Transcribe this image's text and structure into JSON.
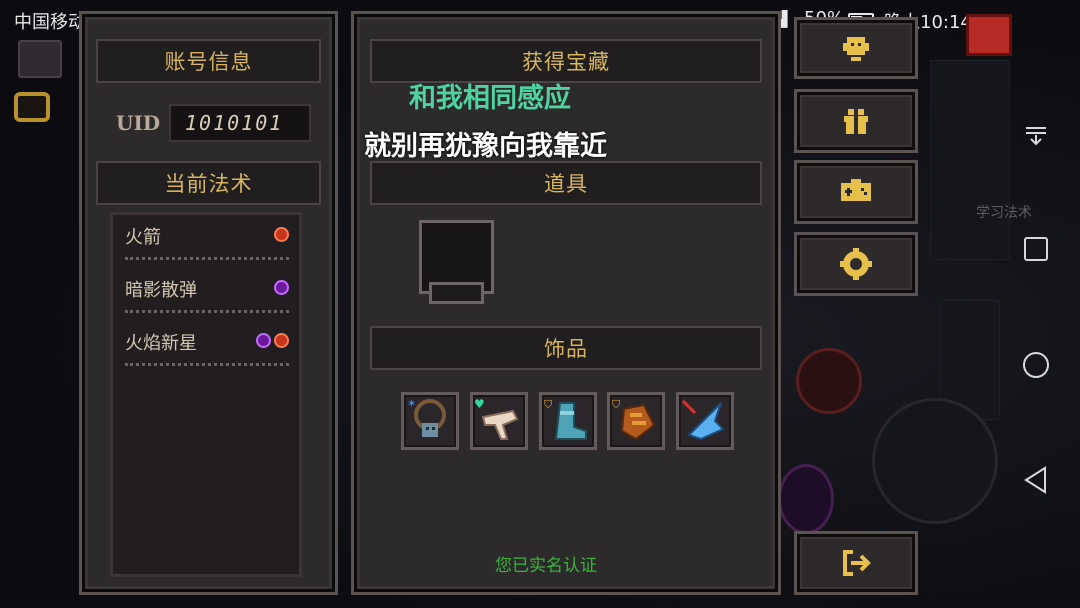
{
  "status_bar": {
    "carrier": "中国移动",
    "net_speed": "0K/s",
    "battery": "50%",
    "time": "晚上10:14"
  },
  "account_panel": {
    "title": "账号信息",
    "uid_label": "UID",
    "uid_value": "1010101",
    "spells_title": "当前法术",
    "spells": [
      {
        "name": "火箭",
        "elements": [
          "fire"
        ]
      },
      {
        "name": "暗影散弹",
        "elements": [
          "shadow"
        ]
      },
      {
        "name": "火焰新星",
        "elements": [
          "shadow",
          "fire"
        ]
      }
    ]
  },
  "treasure_panel": {
    "title": "获得宝藏",
    "items_title": "道具",
    "accessories_title": "饰品",
    "accessories": [
      {
        "icon": "necklace-icon",
        "badge": "star"
      },
      {
        "icon": "bone-charm-icon",
        "badge": "heart"
      },
      {
        "icon": "boot-icon",
        "badge": "shield"
      },
      {
        "icon": "scroll-icon",
        "badge": "shield"
      },
      {
        "icon": "blue-crystal-icon",
        "badge": "arrow"
      }
    ],
    "verified_text": "您已实名认证"
  },
  "lyrics": {
    "line1": "和我相同感应",
    "line2": "就别再犹豫向我靠近"
  },
  "side_menu": {
    "buttons": [
      "support-icon",
      "gift-icon",
      "gamepad-icon",
      "settings-icon",
      "exit-icon"
    ]
  },
  "background": {
    "hint_text": "学习法术"
  },
  "colors": {
    "gold": "#d6b55c",
    "lyric_green": "#4fd3a0",
    "verified_green": "#3ab53a",
    "fire": "#c4361f",
    "shadow": "#6a1a9a"
  }
}
